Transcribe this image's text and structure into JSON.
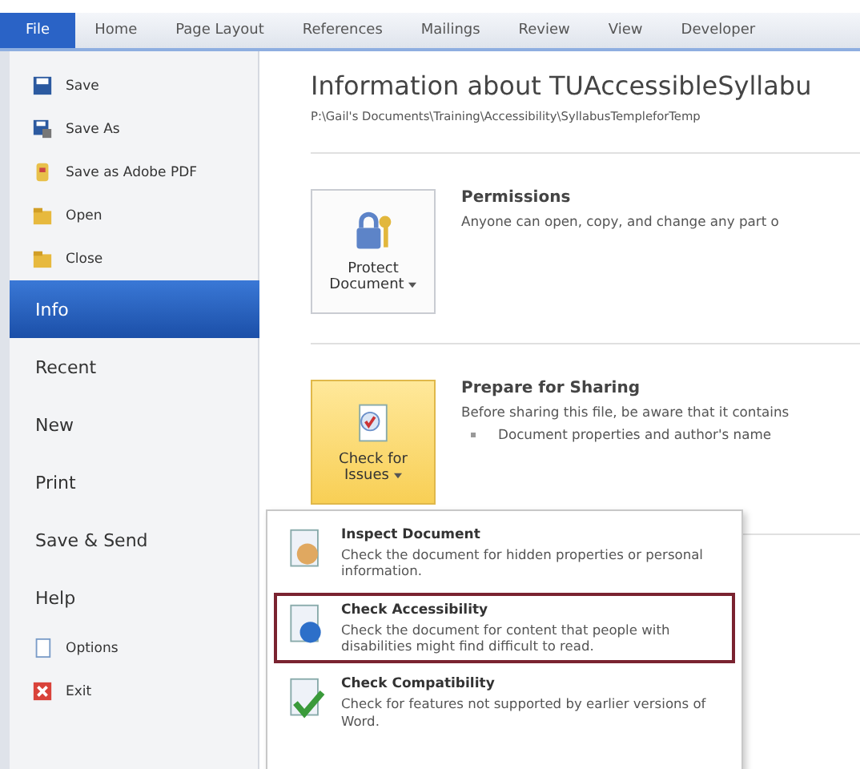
{
  "tabs": [
    {
      "label": "File",
      "selected": true
    },
    {
      "label": "Home",
      "selected": false
    },
    {
      "label": "Page Layout",
      "selected": false
    },
    {
      "label": "References",
      "selected": false
    },
    {
      "label": "Mailings",
      "selected": false
    },
    {
      "label": "Review",
      "selected": false
    },
    {
      "label": "View",
      "selected": false
    },
    {
      "label": "Developer",
      "selected": false
    }
  ],
  "sidebar": {
    "items": [
      {
        "kind": "command",
        "label": "Save",
        "selected": false
      },
      {
        "kind": "command",
        "label": "Save As",
        "selected": false
      },
      {
        "kind": "command",
        "label": "Save as Adobe PDF",
        "selected": false
      },
      {
        "kind": "command",
        "label": "Open",
        "selected": false
      },
      {
        "kind": "command",
        "label": "Close",
        "selected": false
      },
      {
        "kind": "page",
        "label": "Info",
        "selected": true
      },
      {
        "kind": "page",
        "label": "Recent",
        "selected": false
      },
      {
        "kind": "page",
        "label": "New",
        "selected": false
      },
      {
        "kind": "page",
        "label": "Print",
        "selected": false
      },
      {
        "kind": "page",
        "label": "Save & Send",
        "selected": false
      },
      {
        "kind": "page",
        "label": "Help",
        "selected": false
      },
      {
        "kind": "command",
        "label": "Options",
        "selected": false
      },
      {
        "kind": "command",
        "label": "Exit",
        "selected": false
      }
    ]
  },
  "info": {
    "title": "Information about TUAccessibleSyllabu",
    "path": "P:\\Gail's Documents\\Training\\Accessibility\\SyllabusTempleforTemp",
    "sections": [
      {
        "button": "Protect Document",
        "heading": "Permissions",
        "text": "Anyone can open, copy, and change any part o",
        "open": false
      },
      {
        "button": "Check for Issues",
        "heading": "Prepare for Sharing",
        "text": "Before sharing this file, be aware that it contains",
        "bullets": [
          "Document properties and author's name"
        ],
        "open": true
      }
    ]
  },
  "dropdown": {
    "items": [
      {
        "title": "Inspect Document",
        "text": "Check the document for hidden properties or personal information.",
        "selected": false
      },
      {
        "title": "Check Accessibility",
        "text": "Check the document for content that people with disabilities might find difficult to read.",
        "selected": true
      },
      {
        "title": "Check Compatibility",
        "text": "Check for features not supported by earlier versions of Word.",
        "selected": false
      }
    ]
  }
}
